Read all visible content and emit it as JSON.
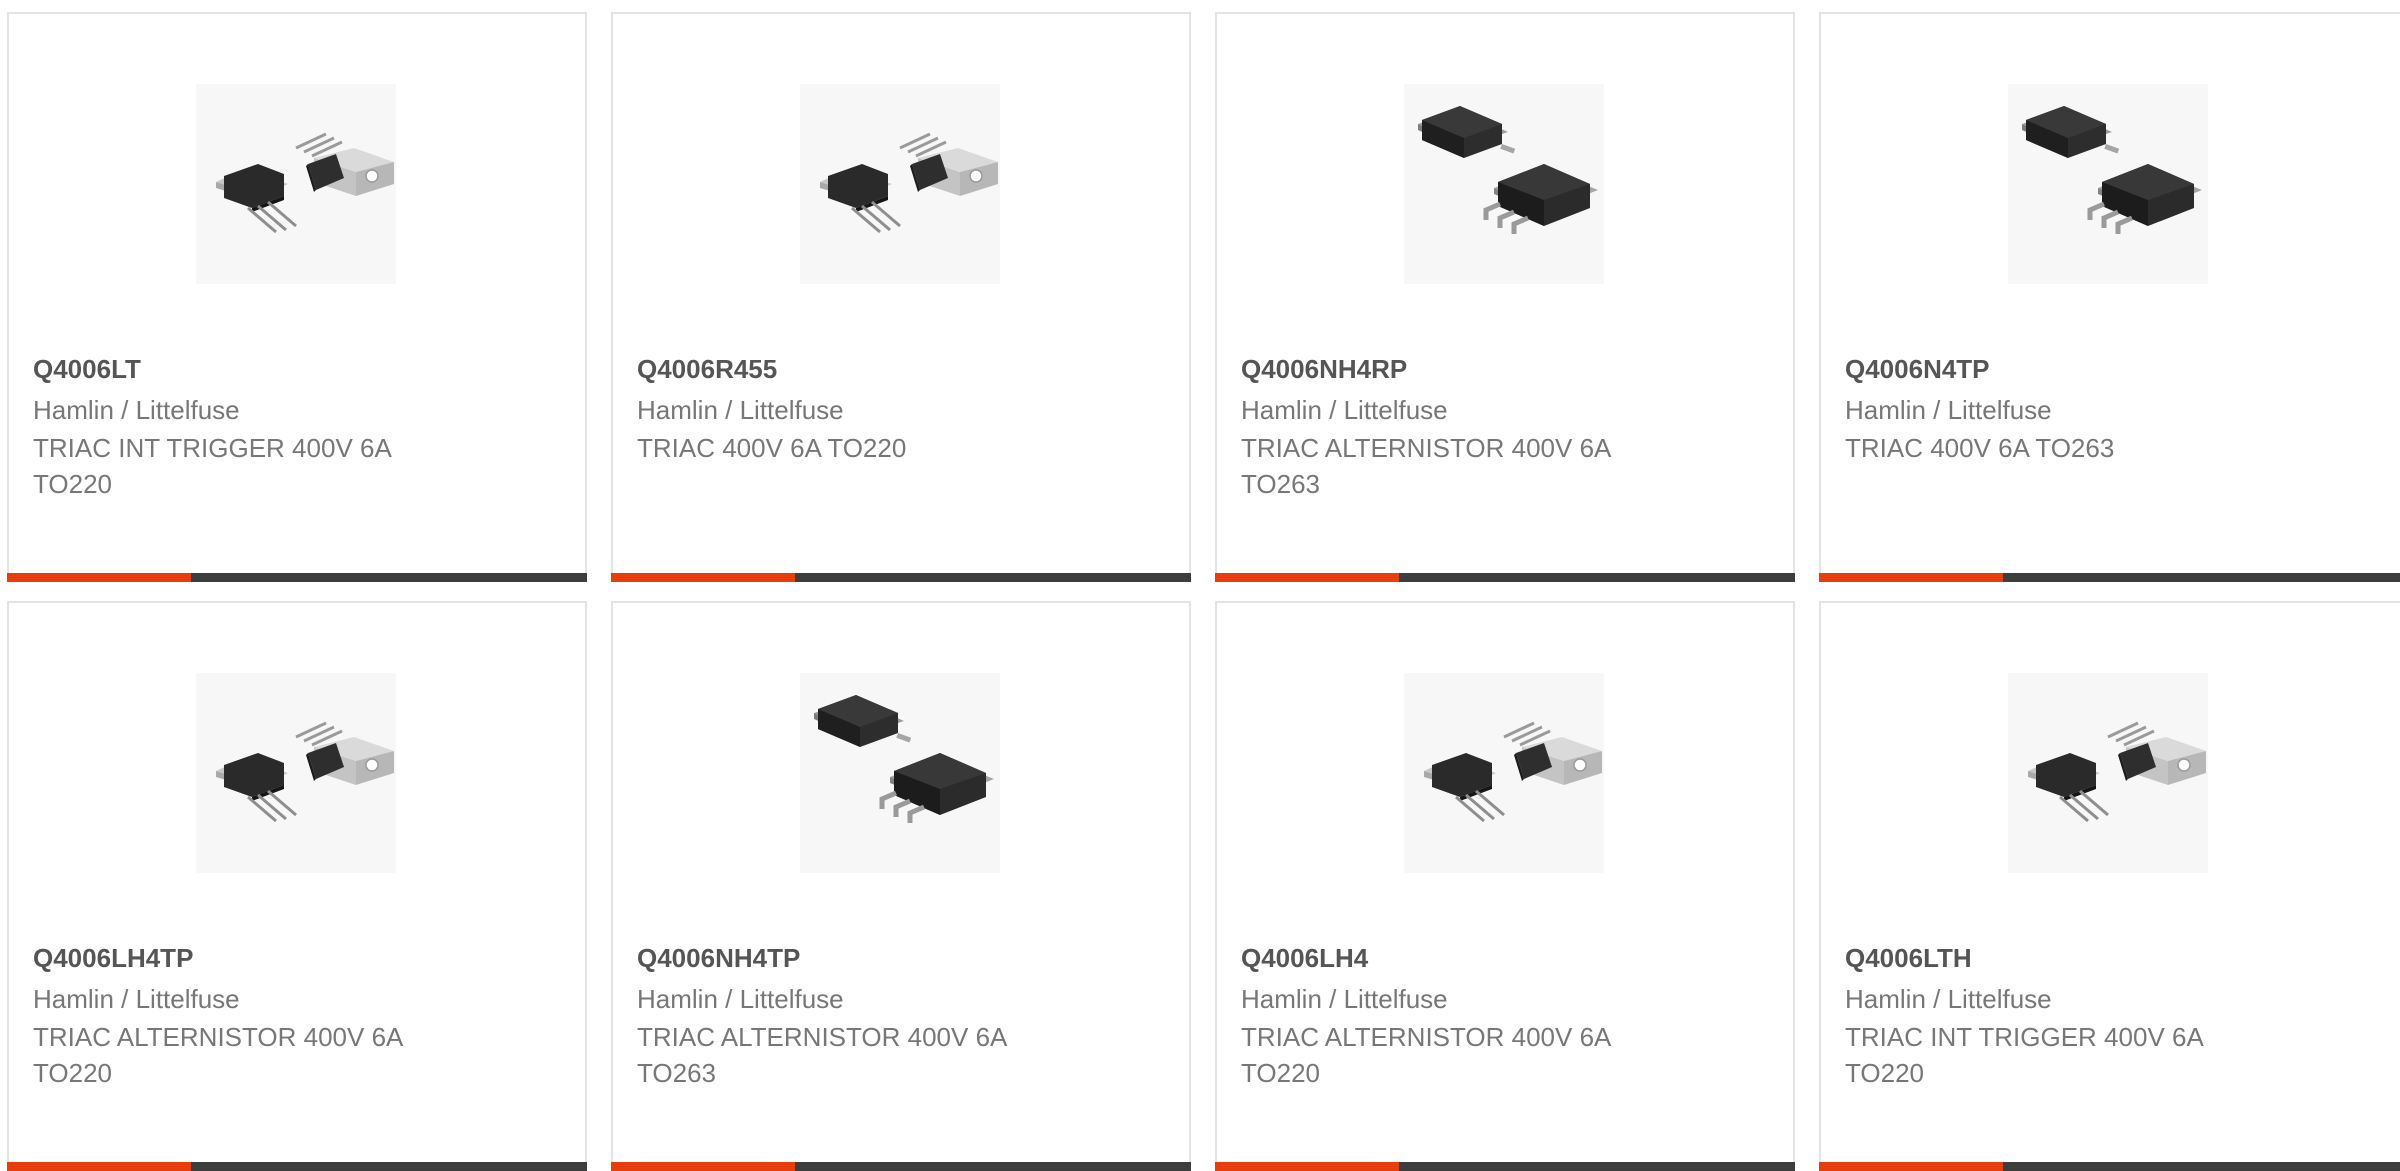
{
  "products": [
    {
      "part_number": "Q4006LT",
      "manufacturer": "Hamlin / Littelfuse",
      "description": "TRIAC INT TRIGGER 400V 6A TO220",
      "image_icon": "to220-package-icon"
    },
    {
      "part_number": "Q4006R455",
      "manufacturer": "Hamlin / Littelfuse",
      "description": "TRIAC 400V 6A TO220",
      "image_icon": "to220-package-icon"
    },
    {
      "part_number": "Q4006NH4RP",
      "manufacturer": "Hamlin / Littelfuse",
      "description": "TRIAC ALTERNISTOR 400V 6A TO263",
      "image_icon": "to263-package-icon"
    },
    {
      "part_number": "Q4006N4TP",
      "manufacturer": "Hamlin / Littelfuse",
      "description": "TRIAC 400V 6A TO263",
      "image_icon": "to263-package-icon"
    },
    {
      "part_number": "Q4006LH4TP",
      "manufacturer": "Hamlin / Littelfuse",
      "description": "TRIAC ALTERNISTOR 400V 6A TO220",
      "image_icon": "to220-package-icon"
    },
    {
      "part_number": "Q4006NH4TP",
      "manufacturer": "Hamlin / Littelfuse",
      "description": "TRIAC ALTERNISTOR 400V 6A TO263",
      "image_icon": "to263-package-icon"
    },
    {
      "part_number": "Q4006LH4",
      "manufacturer": "Hamlin / Littelfuse",
      "description": "TRIAC ALTERNISTOR 400V 6A TO220",
      "image_icon": "to220-package-icon"
    },
    {
      "part_number": "Q4006LTH",
      "manufacturer": "Hamlin / Littelfuse",
      "description": "TRIAC INT TRIGGER 400V 6A TO220",
      "image_icon": "to220-package-icon"
    }
  ],
  "colors": {
    "accent": "#e63e0c",
    "bar": "#3d3d3d",
    "part_number_text": "#555555",
    "body_text": "#777777",
    "border": "#e4e4e4"
  }
}
